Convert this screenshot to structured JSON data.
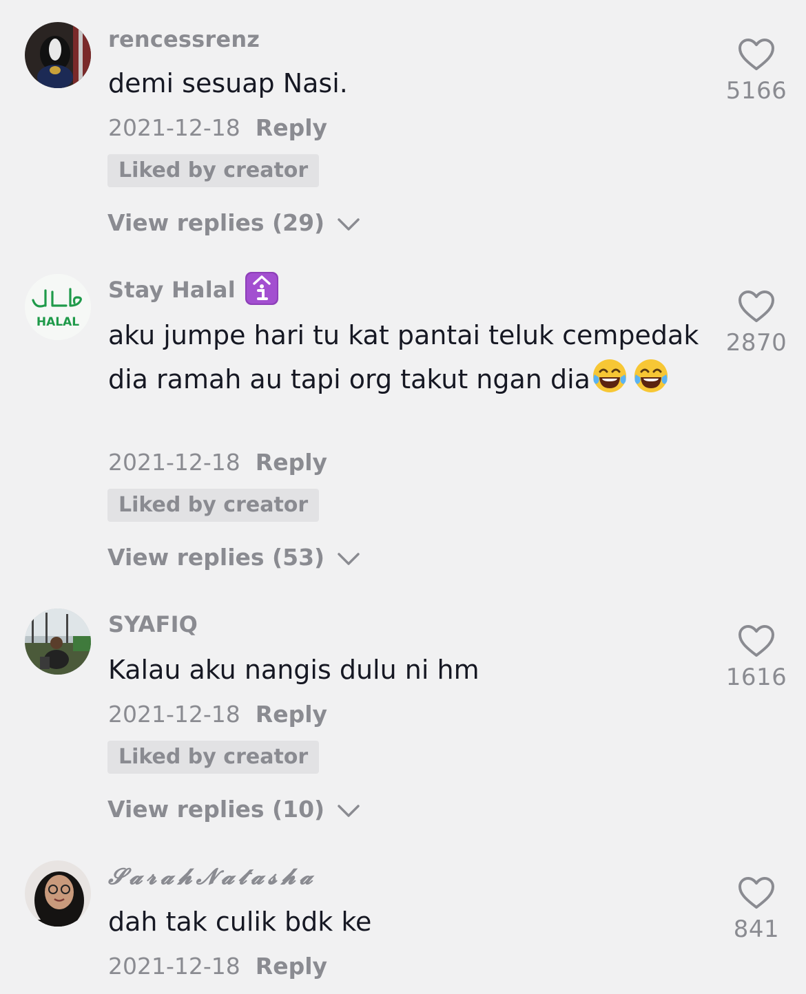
{
  "comments": [
    {
      "username": "rencessrenz",
      "text": "demi sesuap Nasi.",
      "date": "2021-12-18",
      "reply_label": "Reply",
      "liked_label": "Liked by creator",
      "view_replies": "View replies (29)",
      "likes": "5166"
    },
    {
      "username": "Stay Halal",
      "username_badge": "info-emoji-icon",
      "avatar_text": "HALAL",
      "text": "aku jumpe hari tu kat pantai teluk cempedak dia ramah au tapi org takut ngan dia",
      "text_emoji": "tears-of-joy-emoji x2",
      "date": "2021-12-18",
      "reply_label": "Reply",
      "liked_label": "Liked by creator",
      "view_replies": "View replies (53)",
      "likes": "2870"
    },
    {
      "username": "SYAFIQ",
      "text": "Kalau aku nangis dulu ni hm",
      "date": "2021-12-18",
      "reply_label": "Reply",
      "liked_label": "Liked by creator",
      "view_replies": "View replies (10)",
      "likes": "1616"
    },
    {
      "username": "𝓢𝓪𝓻𝓪𝓱𝓝𝓪𝓽𝓪𝓼𝓱𝓪",
      "text": "dah tak culik bdk ke",
      "date": "2021-12-18",
      "reply_label": "Reply",
      "likes": "841"
    }
  ],
  "colors": {
    "background": "#f1f1f2",
    "primary_text": "#161823",
    "secondary_text": "#8a8b91",
    "liked_badge_bg": "#e2e2e4",
    "halal_green": "#1f9a4a"
  },
  "icons": {
    "like": "heart-outline-icon",
    "expand": "chevron-down-icon"
  }
}
